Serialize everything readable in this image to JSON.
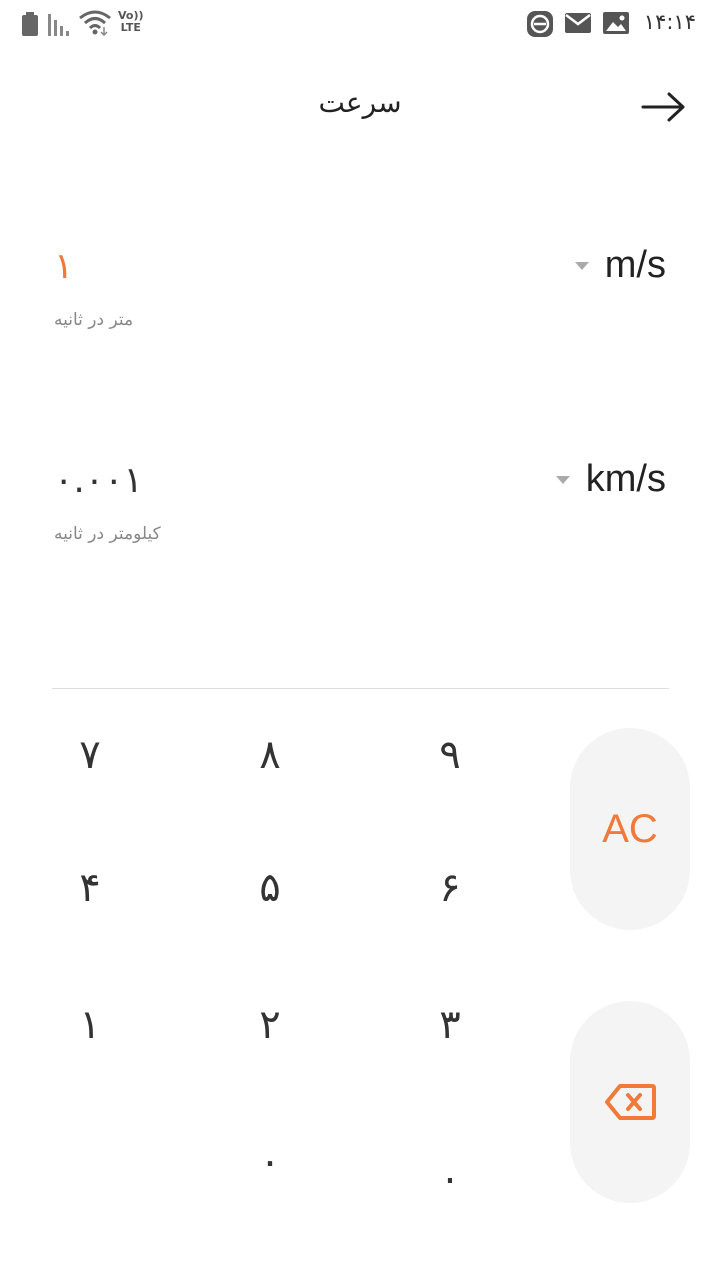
{
  "status_bar": {
    "volte_top": "Vo))",
    "volte_bottom": "LTE",
    "time": "۱۴:۱۴"
  },
  "header": {
    "title": "سرعت"
  },
  "units": [
    {
      "symbol": "m/s",
      "value": "۱",
      "description": "متر در ثانیه",
      "value_color": "#ef7a3a"
    },
    {
      "symbol": "km/s",
      "value": "۰.۰۰۱",
      "description": "کیلومتر در ثانیه",
      "value_color": "#333333"
    }
  ],
  "keypad": {
    "k7": "۷",
    "k8": "۸",
    "k9": "۹",
    "k4": "۴",
    "k5": "۵",
    "k6": "۶",
    "k1": "۱",
    "k2": "۲",
    "k3": "۳",
    "k0": "۰",
    "kdot": ".",
    "ac": "AC"
  },
  "colors": {
    "accent": "#ef7a3a",
    "key_background": "#f4f4f4"
  }
}
